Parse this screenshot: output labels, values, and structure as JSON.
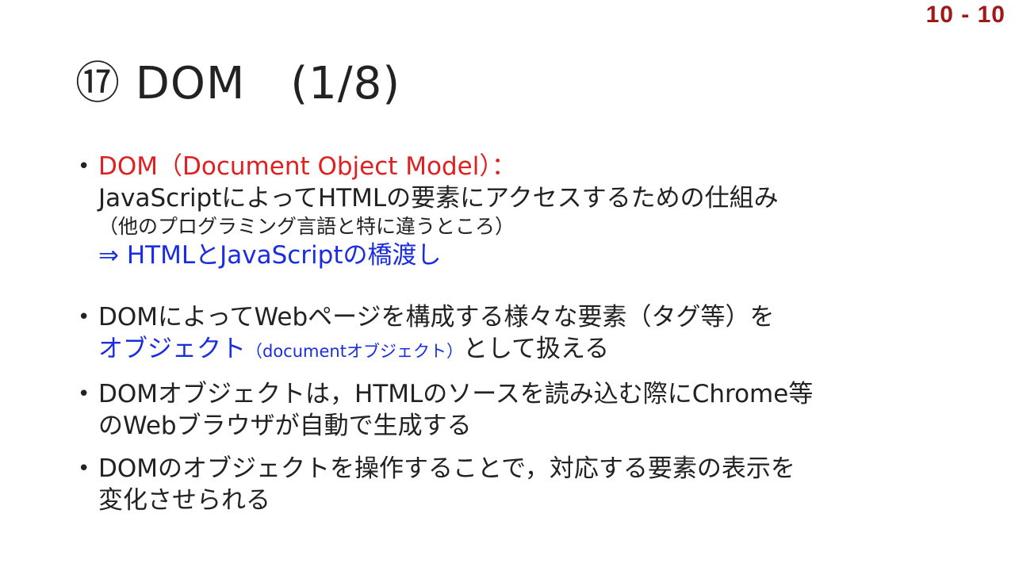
{
  "page_number": "10 - 10",
  "title": "⑰ DOM　(1/8)",
  "bullets": [
    {
      "line1_red": "DOM（Document Object Model）：",
      "line2": "JavaScriptによってHTMLの要素にアクセスするための仕組み",
      "line3_small": "（他のプログラミング言語と特に違うところ）",
      "line4_blue": "⇒ HTMLとJavaScriptの橋渡し"
    },
    {
      "line1": "DOMによってWebページを構成する様々な要素（タグ等）を",
      "line2_blue": "オブジェクト",
      "line2_blue_small": "（documentオブジェクト）",
      "line2_rest": "として扱える"
    },
    {
      "line1": "DOMオブジェクトは，HTMLのソースを読み込む際にChrome等",
      "line2": "のWebブラウザが自動で生成する"
    },
    {
      "line1": "DOMのオブジェクトを操作することで，対応する要素の表示を",
      "line2": "変化させられる"
    }
  ]
}
